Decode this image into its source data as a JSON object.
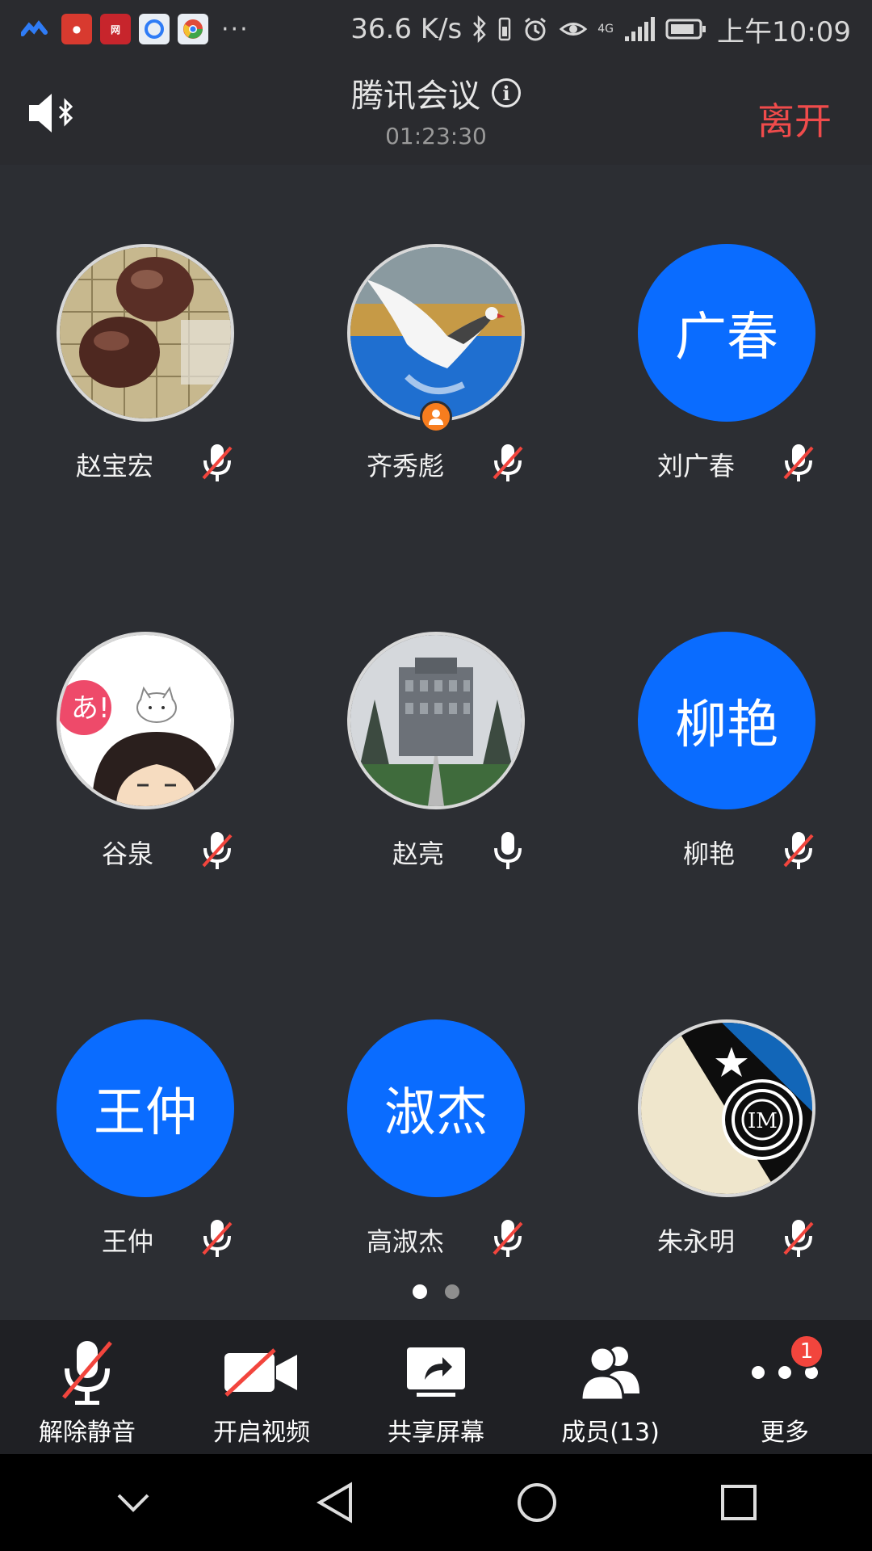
{
  "status_bar": {
    "app_icons": [
      "tencent-meeting",
      "app-red",
      "netease-news",
      "browser-blue",
      "chrome-like"
    ],
    "overflow": "···",
    "network_speed": "36.6 K/s",
    "network_type": "4G",
    "time": "上午10:09"
  },
  "header": {
    "title": "腾讯会议",
    "timer": "01:23:30",
    "leave_label": "离开"
  },
  "participants": [
    {
      "name": "赵宝宏",
      "avatar_text": "",
      "avatar": "go-stones-photo",
      "muted": true
    },
    {
      "name": "齐秀彪",
      "avatar_text": "",
      "avatar": "seagull-photo",
      "muted": true,
      "host": true
    },
    {
      "name": "刘广春",
      "avatar_text": "广春",
      "avatar": "initials",
      "muted": true
    },
    {
      "name": "谷泉",
      "avatar_text": "",
      "avatar": "anime-girl-cat",
      "muted": true
    },
    {
      "name": "赵亮",
      "avatar_text": "",
      "avatar": "building-photo",
      "muted": false
    },
    {
      "name": "柳艳",
      "avatar_text": "柳艳",
      "avatar": "initials",
      "muted": true
    },
    {
      "name": "王仲",
      "avatar_text": "王仲",
      "avatar": "initials",
      "muted": true
    },
    {
      "name": "高淑杰",
      "avatar_text": "淑杰",
      "avatar": "initials",
      "muted": true
    },
    {
      "name": "朱永明",
      "avatar_text": "",
      "avatar": "inter-milan-logo",
      "muted": true
    }
  ],
  "pagination": {
    "pages": 2,
    "current": 1
  },
  "toolbar": {
    "unmute": "解除静音",
    "video": "开启视频",
    "share": "共享屏幕",
    "members": "成员(13)",
    "more": "更多",
    "more_badge": "1"
  },
  "colors": {
    "accent_blue": "#0a6cff",
    "leave_red": "#f04b4b",
    "mute_slash_red": "#f2453d",
    "host_orange": "#f77d1e",
    "background": "#2c2e33",
    "toolbar": "#1f2024"
  }
}
